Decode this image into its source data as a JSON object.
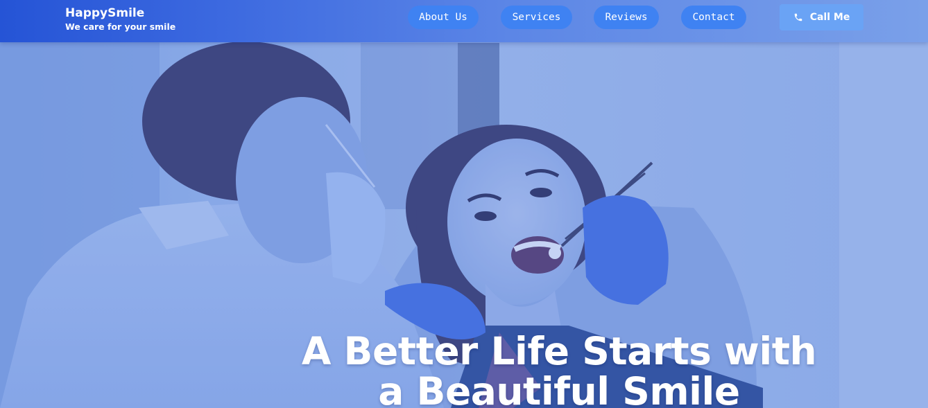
{
  "brand": {
    "name": "HappySmile",
    "tagline": "We care for your smile"
  },
  "nav": {
    "items": [
      {
        "label": "About Us"
      },
      {
        "label": "Services"
      },
      {
        "label": "Reviews"
      },
      {
        "label": "Contact"
      }
    ],
    "call_label": "Call Me",
    "call_icon": "phone-icon"
  },
  "hero": {
    "headline": "A Better Life Starts with a Beautiful Smile",
    "image": "dentist-patient-photo",
    "overlay_color": "#4a78e0"
  },
  "colors": {
    "header_start": "#2554d6",
    "header_end": "#7aa0e9",
    "nav_pill": "#3f82f2",
    "call_button": "#6aa3f5"
  }
}
